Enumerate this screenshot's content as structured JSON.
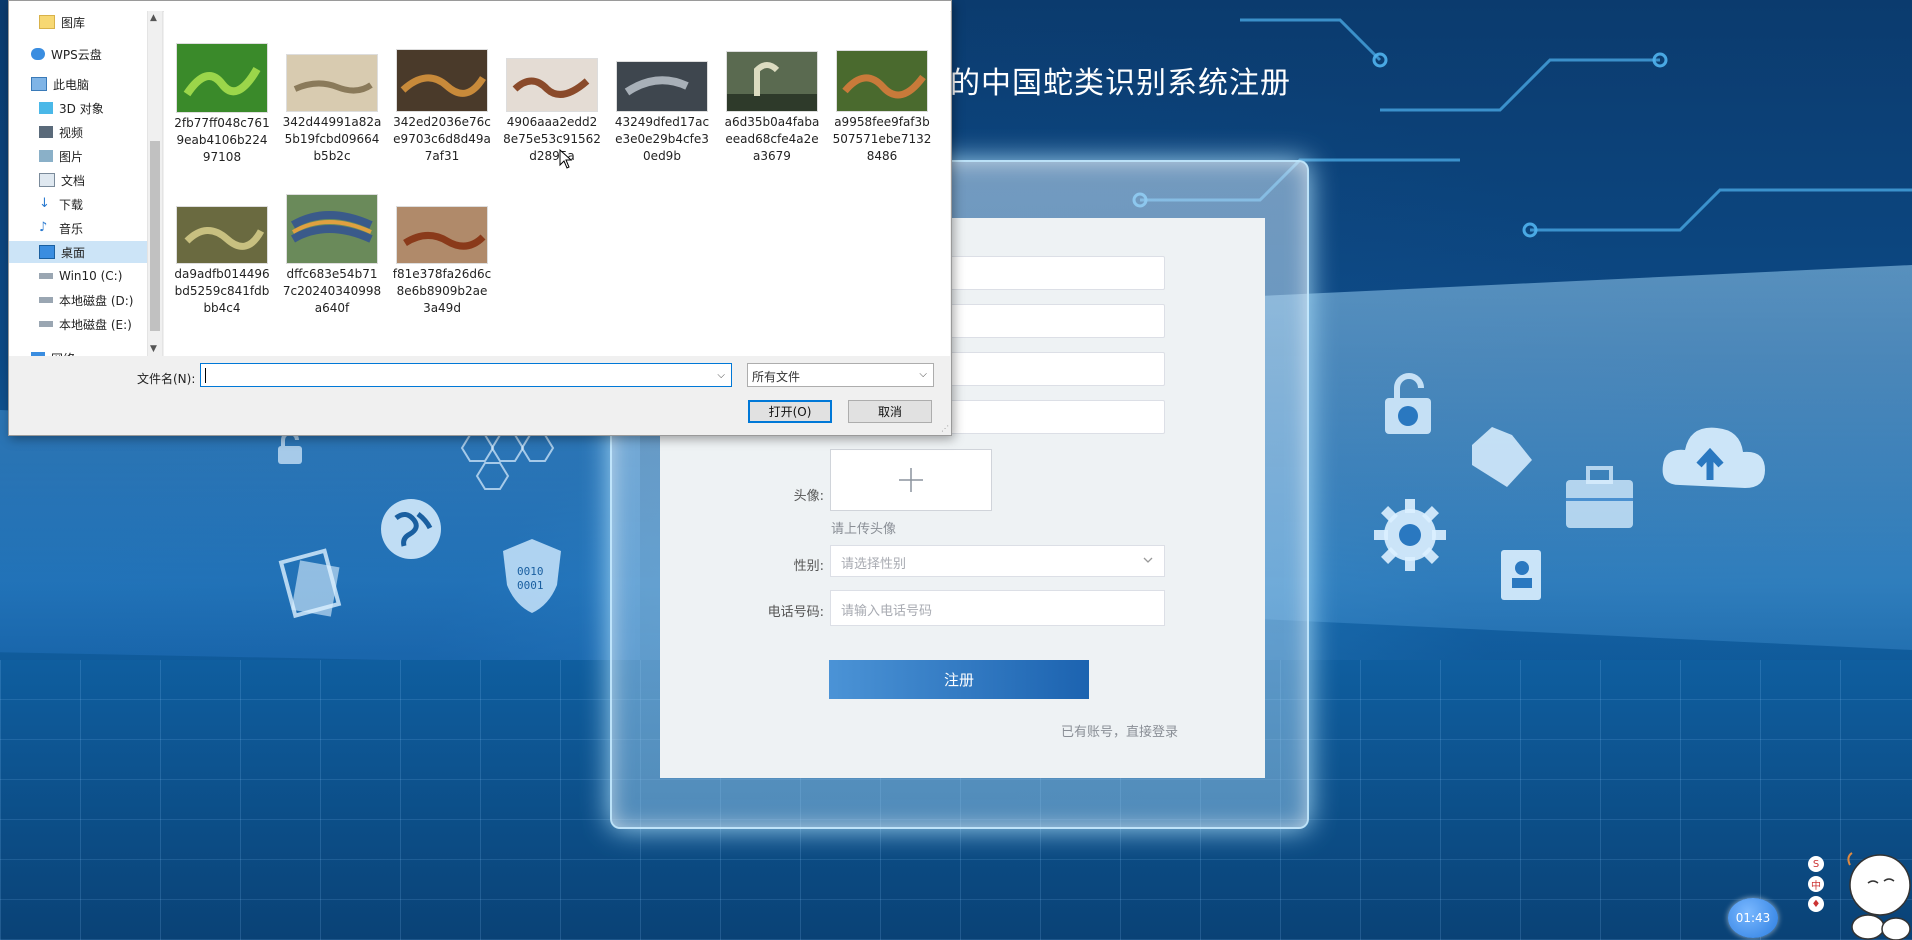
{
  "page": {
    "title_partial": "的中国蛇类识别系统注册"
  },
  "register_form": {
    "avatar_label": "头像:",
    "avatar_hint": "请上传头像",
    "gender_label": "性别:",
    "gender_placeholder": "请选择性别",
    "phone_label": "电话号码:",
    "phone_placeholder": "请输入电话号码",
    "submit_label": "注册",
    "login_link": "已有账号，直接登录"
  },
  "file_dialog": {
    "nav_items": [
      {
        "label": "图库",
        "icon": "folder-icon"
      },
      {
        "label": "WPS云盘",
        "icon": "cloud-icon"
      },
      {
        "label": "此电脑",
        "icon": "computer-icon"
      },
      {
        "label": "3D 对象",
        "icon": "cube-icon"
      },
      {
        "label": "视频",
        "icon": "video-icon"
      },
      {
        "label": "图片",
        "icon": "picture-icon"
      },
      {
        "label": "文档",
        "icon": "document-icon"
      },
      {
        "label": "下载",
        "icon": "download-icon"
      },
      {
        "label": "音乐",
        "icon": "music-icon"
      },
      {
        "label": "桌面",
        "icon": "desktop-icon",
        "selected": true
      },
      {
        "label": "Win10 (C:)",
        "icon": "drive-icon"
      },
      {
        "label": "本地磁盘 (D:)",
        "icon": "drive-icon"
      },
      {
        "label": "本地磁盘 (E:)",
        "icon": "drive-icon"
      },
      {
        "label": "网络",
        "icon": "network-icon"
      }
    ],
    "files": [
      {
        "name": "2fb77ff048c7619eab4106b22497108",
        "lines": [
          "2fb77ff048c761",
          "9eab4106b224",
          "97108"
        ],
        "color": "#3a8a2a"
      },
      {
        "name": "342d44991a82a5b19fcbd09664b5b2c",
        "lines": [
          "342d44991a82a",
          "5b19fcbd09664",
          "b5b2c"
        ],
        "color": "#b9a889"
      },
      {
        "name": "342ed2036e76ce9703c6d8d49a7af31",
        "lines": [
          "342ed2036e76c",
          "e9703c6d8d49a",
          "7af31"
        ],
        "color": "#6b4a2a"
      },
      {
        "name": "4906aaa2edd28e75e53c91562d2895a",
        "lines": [
          "4906aaa2edd2",
          "8e75e53c91562",
          "d2895a"
        ],
        "color": "#a77a5a"
      },
      {
        "name": "43249dfed17ace3e0e29b4cfe30ed9b",
        "lines": [
          "43249dfed17ac",
          "e3e0e29b4cfe3",
          "0ed9b"
        ],
        "color": "#55606a"
      },
      {
        "name": "a6d35b0a4fabaeead68cfe4a2ea3679",
        "lines": [
          "a6d35b0a4faba",
          "eead68cfe4a2e",
          "a3679"
        ],
        "color": "#3c4a38"
      },
      {
        "name": "a9958fee9faf3b507571ebe71328486",
        "lines": [
          "a9958fee9faf3b",
          "507571ebe7132",
          "8486"
        ],
        "color": "#4c6a2e"
      },
      {
        "name": "da9adfb014496bd5259c841fdbbb4c4",
        "lines": [
          "da9adfb014496",
          "bd5259c841fdb",
          "bb4c4"
        ],
        "color": "#7a7a4a"
      },
      {
        "name": "dffc683e54b717c20240340998a640f",
        "lines": [
          "dffc683e54b71",
          "7c20240340998",
          "a640f"
        ],
        "color": "#4a6a8a"
      },
      {
        "name": "f81e378fa26d6c8e6b8909b2ae3a49d",
        "lines": [
          "f81e378fa26d6c",
          "8e6b8909b2ae",
          "3a49d"
        ],
        "color": "#8a5a3a"
      }
    ],
    "filename_label": "文件名(N):",
    "filename_value": "",
    "filetype_value": "所有文件",
    "open_label": "打开(O)",
    "cancel_label": "取消"
  },
  "widgets": {
    "timer": "01:43"
  }
}
